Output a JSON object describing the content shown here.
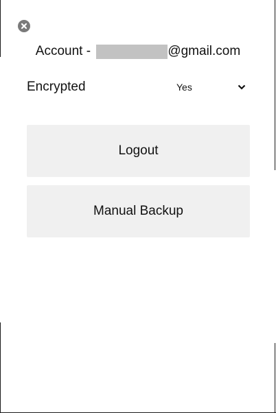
{
  "account": {
    "prefix": "Account - ",
    "email_domain": "@gmail.com"
  },
  "encrypted": {
    "label": "Encrypted",
    "selected": "Yes"
  },
  "buttons": {
    "logout": "Logout",
    "manual_backup": "Manual Backup"
  },
  "icons": {
    "close": "close-icon",
    "dropdown": "chevron-down-icon"
  },
  "colors": {
    "button_bg": "#f0f0f0",
    "close_icon": "#7a7a7a",
    "redaction": "#c2c2c2"
  }
}
